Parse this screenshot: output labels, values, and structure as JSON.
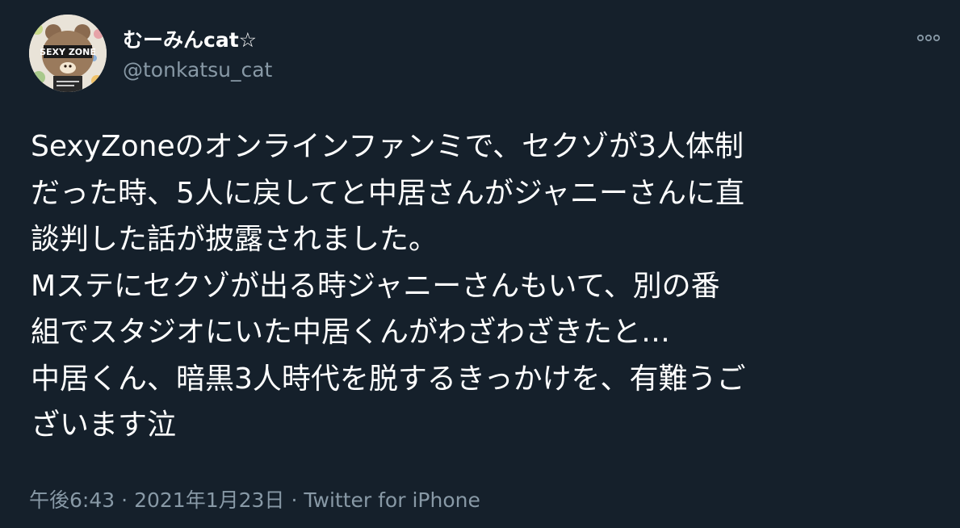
{
  "tweet": {
    "author": {
      "display_name": "むーみんcat☆",
      "handle": "@tonkatsu_cat",
      "avatar_text": "SEXY ZONE"
    },
    "more_icon": "more-dots-icon",
    "text_lines": [
      "SexyZoneのオンラインファンミで、セクゾが3人体制",
      "だった時、5人に戻してと中居さんがジャニーさんに直",
      "談判した話が披露されました。",
      "Mステにセクゾが出る時ジャニーさんもいて、別の番",
      "組でスタジオにいた中居くんがわざわざきたと…",
      "中居くん、暗黒3人時代を脱するきっかけを、有難うご",
      "ざいます泣"
    ],
    "meta": {
      "time": "午後6:43",
      "separator": "·",
      "date": "2021年1月23日",
      "source": "Twitter for iPhone"
    }
  },
  "colors": {
    "background": "#15202b",
    "primary_text": "#ffffff",
    "secondary_text": "#8899a6"
  }
}
